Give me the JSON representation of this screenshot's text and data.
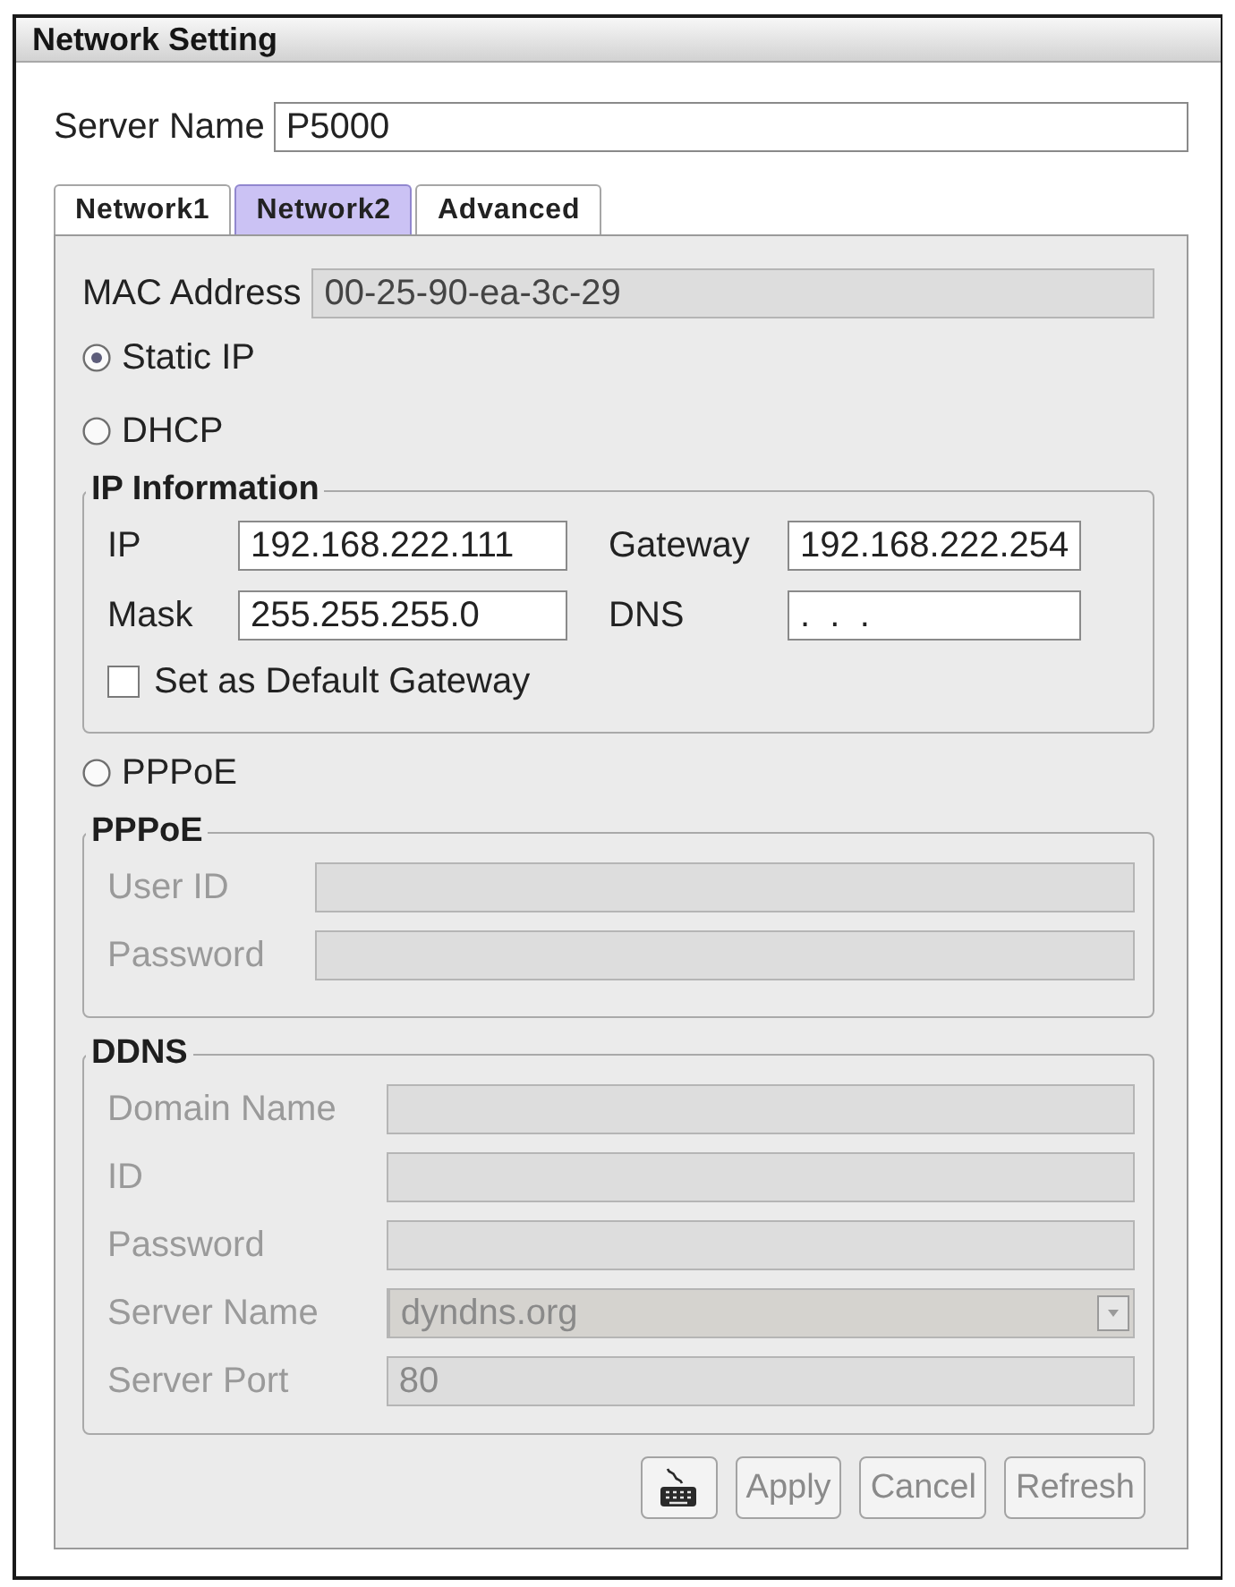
{
  "window": {
    "title": "Network Setting"
  },
  "server_name": {
    "label": "Server Name",
    "value": "P5000"
  },
  "tabs": [
    {
      "label": "Network1",
      "selected": false
    },
    {
      "label": "Network2",
      "selected": true
    },
    {
      "label": "Advanced",
      "selected": false
    }
  ],
  "panel": {
    "items": [
      {
        "kind": "field",
        "label": "MAC Address",
        "value": "00-25-90-ea-3c-29",
        "disabled": true
      },
      {
        "kind": "radio",
        "label": "Static IP",
        "selected": true
      },
      {
        "kind": "radio",
        "label": "DHCP",
        "selected": false
      },
      {
        "kind": "grid",
        "title": "IP Information",
        "disabled": false,
        "fields": [
          {
            "kind": "text",
            "label": "IP",
            "value": "192.168.222.111"
          },
          {
            "kind": "text",
            "label": "Gateway",
            "value": "192.168.222.254"
          },
          {
            "kind": "text",
            "label": "Mask",
            "value": "255.255.255.0"
          },
          {
            "kind": "text",
            "label": "DNS",
            "value": ".  .  ."
          }
        ],
        "checkbox": {
          "label": "Set as Default Gateway",
          "checked": false
        }
      },
      {
        "kind": "radio",
        "label": "PPPoE",
        "selected": false
      },
      {
        "kind": "form",
        "title": "PPPoE",
        "disabled": true,
        "fields": [
          {
            "kind": "text",
            "label": "User ID"
          },
          {
            "kind": "text",
            "label": "Password"
          }
        ]
      },
      {
        "kind": "form",
        "title": "DDNS",
        "disabled": true,
        "fields": [
          {
            "kind": "text",
            "label": "Domain Name"
          },
          {
            "kind": "text",
            "label": "ID"
          },
          {
            "kind": "text",
            "label": "Password"
          },
          {
            "kind": "dropdown",
            "label": "Server Name",
            "value": "dyndns.org"
          },
          {
            "kind": "text",
            "label": "Server Port",
            "value": "80"
          }
        ]
      }
    ],
    "buttons": [
      {
        "kind": "keyboard",
        "disabled": false
      },
      {
        "kind": "text",
        "label": "Apply",
        "disabled": true
      },
      {
        "kind": "text",
        "label": "Cancel",
        "disabled": true
      },
      {
        "kind": "text",
        "label": "Refresh",
        "disabled": true
      }
    ]
  }
}
